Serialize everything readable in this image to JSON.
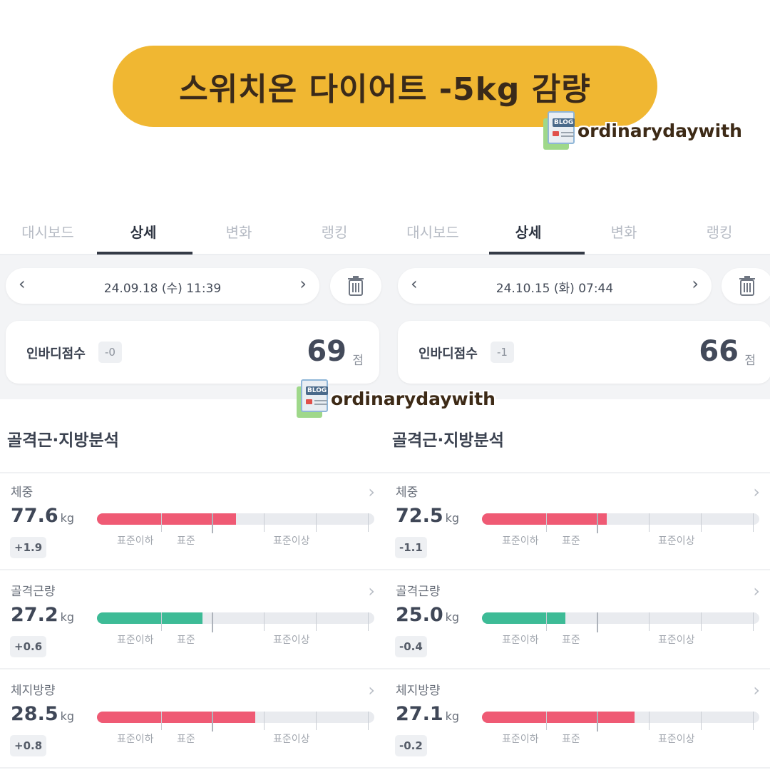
{
  "banner": {
    "title": "스위치온 다이어트 -5kg 감량"
  },
  "watermark": {
    "text": "ordinarydaywith",
    "tag": "BLOG"
  },
  "panels": [
    {
      "tabs": [
        "대시보드",
        "상세",
        "변화",
        "랭킹"
      ],
      "active_tab": 1,
      "date": "24.09.18 (수) 11:39",
      "score": {
        "label": "인바디점수",
        "badge": "-0",
        "value": "69",
        "unit": "점"
      },
      "section_title": "골격근·지방분석",
      "metrics": [
        {
          "name": "체중",
          "value": "77.6",
          "unit": "kg",
          "change": "+1.9",
          "fill_fraction": 0.5,
          "color": "#ef5a74"
        },
        {
          "name": "골격근량",
          "value": "27.2",
          "unit": "kg",
          "change": "+0.6",
          "fill_fraction": 0.38,
          "color": "#3dbb96"
        },
        {
          "name": "체지방량",
          "value": "28.5",
          "unit": "kg",
          "change": "+0.8",
          "fill_fraction": 0.57,
          "color": "#ef5a74"
        }
      ]
    },
    {
      "tabs": [
        "대시보드",
        "상세",
        "변화",
        "랭킹"
      ],
      "active_tab": 1,
      "date": "24.10.15 (화) 07:44",
      "score": {
        "label": "인바디점수",
        "badge": "-1",
        "value": "66",
        "unit": "점"
      },
      "section_title": "골격근·지방분석",
      "metrics": [
        {
          "name": "체중",
          "value": "72.5",
          "unit": "kg",
          "change": "-1.1",
          "fill_fraction": 0.45,
          "color": "#ef5a74"
        },
        {
          "name": "골격근량",
          "value": "25.0",
          "unit": "kg",
          "change": "-0.4",
          "fill_fraction": 0.3,
          "color": "#3dbb96"
        },
        {
          "name": "체지방량",
          "value": "27.1",
          "unit": "kg",
          "change": "-0.2",
          "fill_fraction": 0.55,
          "color": "#ef5a74"
        }
      ]
    }
  ],
  "bar_labels": [
    "표준이하",
    "표준",
    "표준이상"
  ]
}
